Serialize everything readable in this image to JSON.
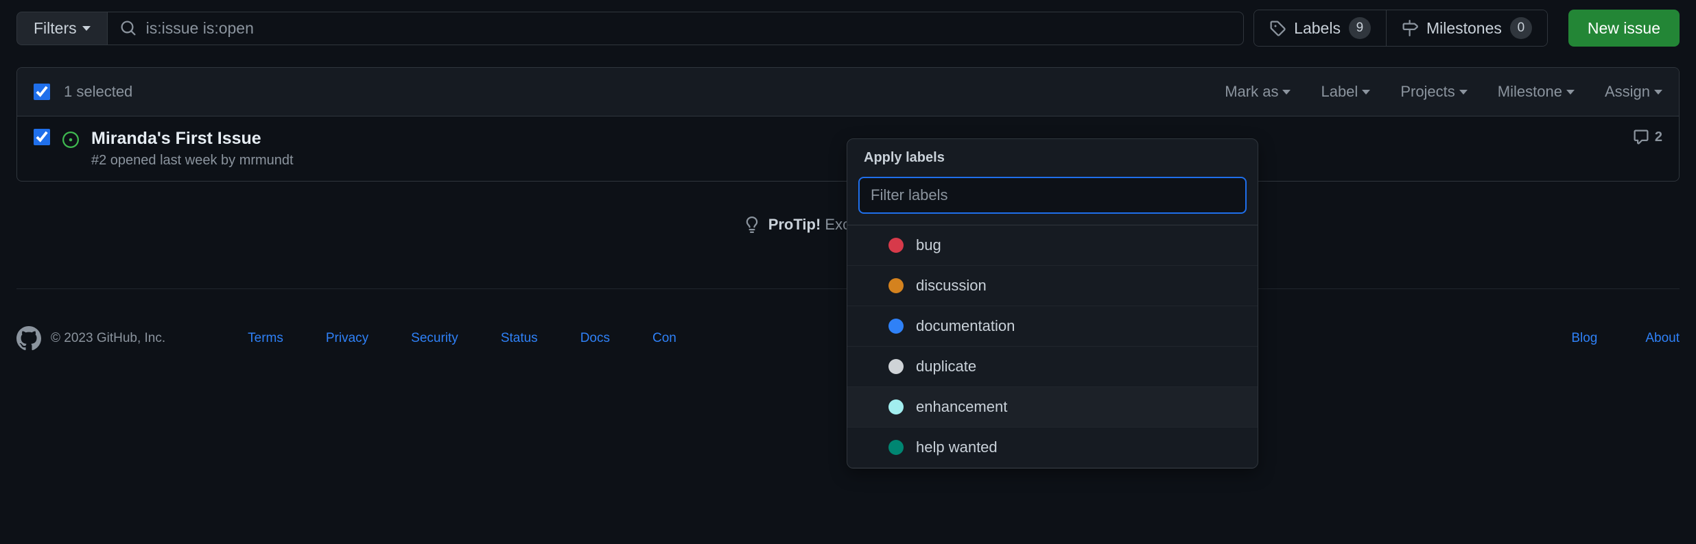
{
  "toolbar": {
    "filters_label": "Filters",
    "search_value": "is:issue is:open",
    "labels_label": "Labels",
    "labels_count": "9",
    "milestones_label": "Milestones",
    "milestones_count": "0",
    "new_issue_label": "New issue"
  },
  "issues_header": {
    "selected_text": "1 selected",
    "actions": {
      "mark_as": "Mark as",
      "label": "Label",
      "projects": "Projects",
      "milestone": "Milestone",
      "assign": "Assign"
    }
  },
  "issue": {
    "title": "Miranda's First Issue",
    "meta": "#2 opened last week by mrmundt",
    "comment_count": "2"
  },
  "protip": {
    "label": "ProTip!",
    "text": "Exclude everything"
  },
  "label_dropdown": {
    "title": "Apply labels",
    "filter_placeholder": "Filter labels",
    "items": [
      {
        "name": "bug",
        "color": "#d73a4a"
      },
      {
        "name": "discussion",
        "color": "#d4821e"
      },
      {
        "name": "documentation",
        "color": "#2f81f7"
      },
      {
        "name": "duplicate",
        "color": "#cfd3d7"
      },
      {
        "name": "enhancement",
        "color": "#a2eeef"
      },
      {
        "name": "help wanted",
        "color": "#008672"
      }
    ]
  },
  "footer": {
    "copyright": "© 2023 GitHub, Inc.",
    "links_left": [
      "Terms",
      "Privacy",
      "Security",
      "Status",
      "Docs",
      "Con"
    ],
    "links_right": [
      "Blog",
      "About"
    ]
  }
}
